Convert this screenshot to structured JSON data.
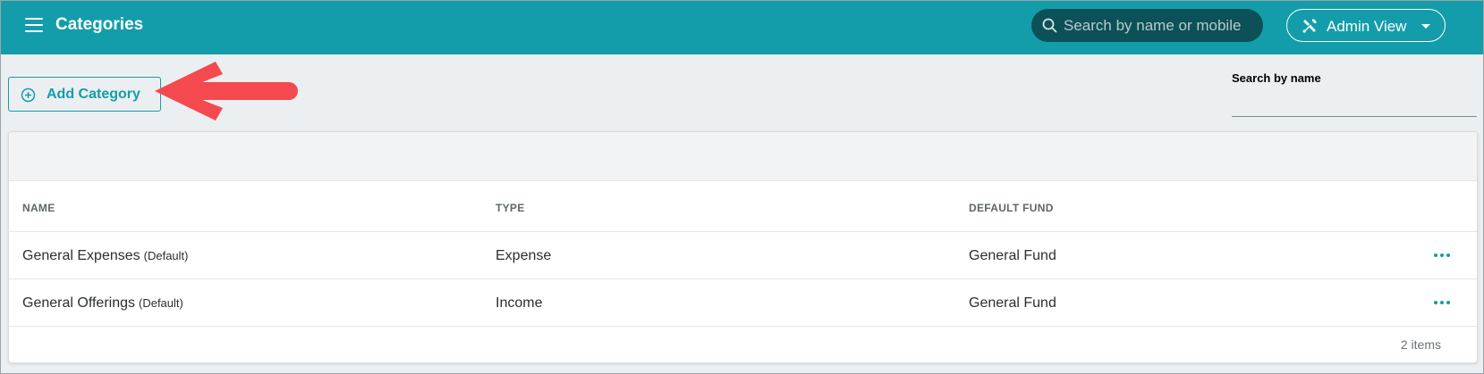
{
  "header": {
    "title": "Categories",
    "search_placeholder": "Search by name or mobile",
    "admin_label": "Admin View"
  },
  "toolbar": {
    "add_label": "Add Category",
    "filter_label": "Search by name"
  },
  "table": {
    "columns": [
      "NAME",
      "TYPE",
      "DEFAULT FUND"
    ],
    "rows": [
      {
        "name": "General Expenses",
        "tag": "(Default)",
        "type": "Expense",
        "fund": "General Fund"
      },
      {
        "name": "General Offerings",
        "tag": "(Default)",
        "type": "Income",
        "fund": "General Fund"
      }
    ],
    "count_text": "2 items"
  },
  "colors": {
    "brand": "#139daa",
    "search_bg": "#0b5157",
    "annotation": "#f44a4f"
  },
  "icons": [
    "menu-icon",
    "search-icon",
    "tools-icon",
    "caret-down-icon",
    "plus-circle-icon",
    "more-dots-icon",
    "arrow-annotation"
  ]
}
